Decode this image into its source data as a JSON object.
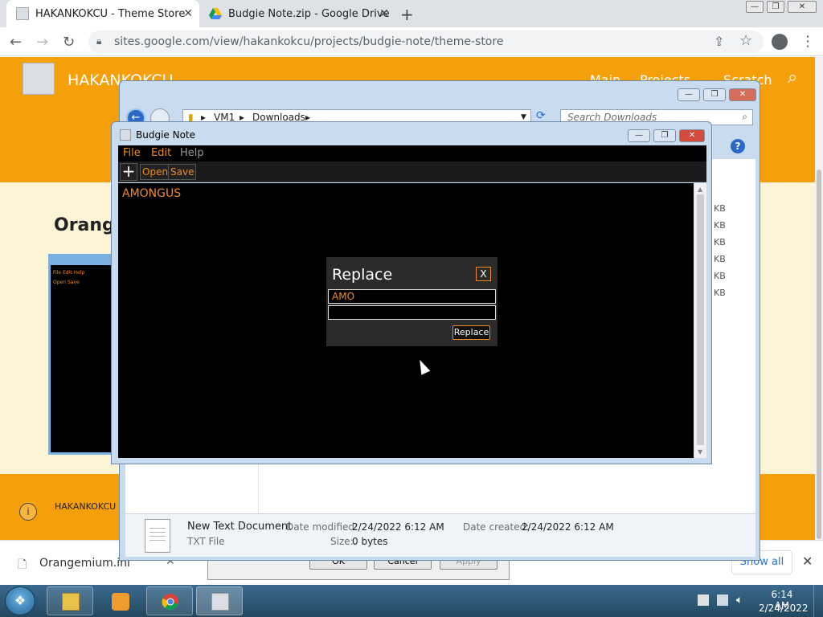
{
  "browser": {
    "tabs": [
      {
        "title": "HAKANKOKCU - Theme Store",
        "active": true
      },
      {
        "title": "Budgie Note.zip - Google Drive",
        "active": false
      }
    ],
    "new_tab_label": "+",
    "url": "sites.google.com/view/hakankokcu/projects/budgie-note/theme-store",
    "window_controls": {
      "minimize": "—",
      "maximize": "❐",
      "close": "✕"
    }
  },
  "site": {
    "title": "HAKANKOKCU",
    "nav": [
      "Main",
      "Projects",
      "Scratch"
    ],
    "heading": "Orange",
    "thumbnail": {
      "menu": "File  Edit  Help",
      "tools": "Open Save"
    },
    "footer_text": "HAKANKOKCU",
    "accent_color": "#f5a00b"
  },
  "explorer": {
    "breadcrumb": [
      "VM1",
      "Downloads"
    ],
    "search_placeholder": "Search Downloads",
    "size_column": [
      "KB",
      "KB",
      "KB",
      "KB",
      "KB",
      "KB"
    ],
    "details": {
      "name": "New Text Document",
      "type": "TXT File",
      "modified_label": "Date modified:",
      "modified_value": "2/24/2022 6:12 AM",
      "size_label": "Size:",
      "size_value": "0 bytes",
      "created_label": "Date created:",
      "created_value": "2/24/2022 6:12 AM"
    }
  },
  "budgie_note": {
    "title": "Budgie Note",
    "menu": [
      "File",
      "Edit",
      "Help"
    ],
    "toolbar": {
      "new": "+",
      "open": "Open",
      "save": "Save"
    },
    "content": "AMONGUS",
    "text_color": "#f08a24",
    "background_color": "#000000"
  },
  "replace_dialog": {
    "title": "Replace",
    "close_label": "X",
    "find_value": "AMO",
    "replace_value": "",
    "button_label": "Replace"
  },
  "properties_buttons": [
    "OK",
    "Cancel",
    "Apply"
  ],
  "download_bar": {
    "file_name": "Orangemium.ini",
    "show_all": "Show all"
  },
  "taskbar": {
    "time": "6:14 AM",
    "date": "2/24/2022"
  }
}
